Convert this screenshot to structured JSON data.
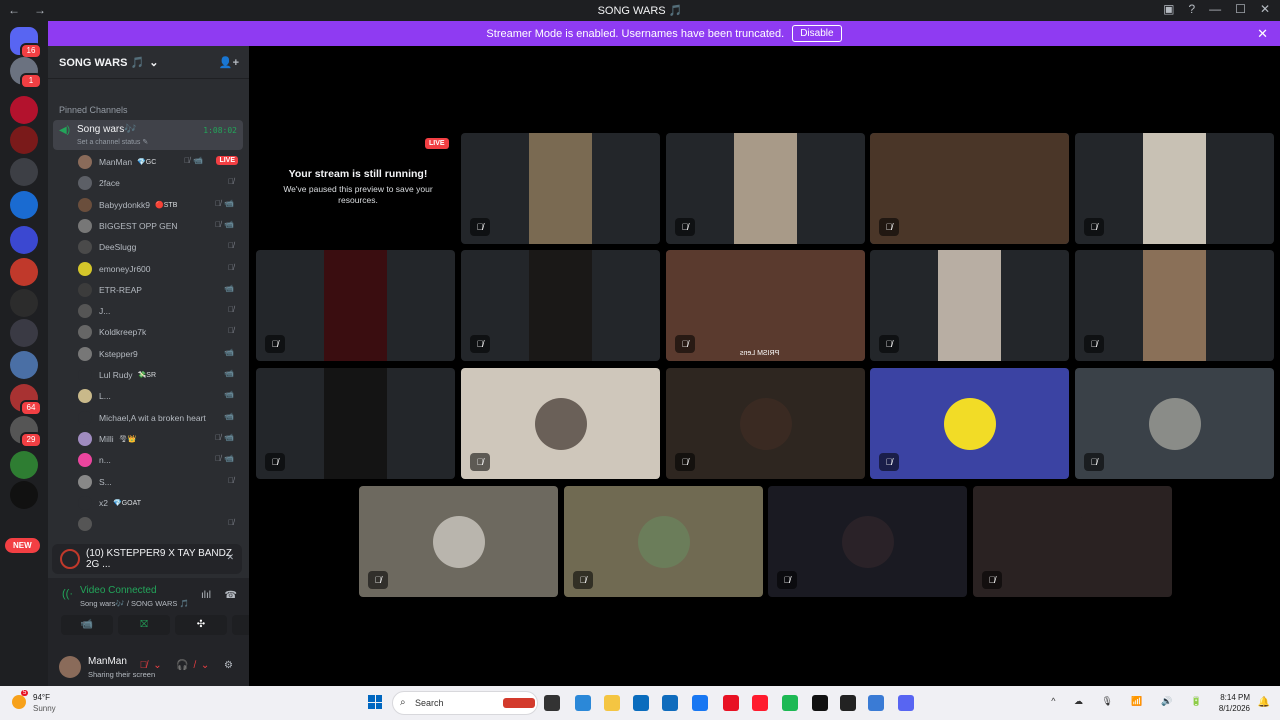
{
  "window": {
    "title": "SONG WARS 🎵",
    "title_icon": "crowd-emoji-icon",
    "back": "←",
    "forward": "→",
    "controls": [
      "▣",
      "?",
      "—",
      "☐",
      "✕"
    ]
  },
  "banner": {
    "text": "Streamer Mode is enabled. Usernames have been truncated.",
    "button": "Disable",
    "close": "✕",
    "color": "#8f3bf2"
  },
  "guilds": {
    "items": [
      {
        "name": "discord-home-icon",
        "badge": "16",
        "color": "#5865f2"
      },
      {
        "name": "server-icon-2",
        "badge": "1",
        "color": "#6b7280"
      },
      {
        "name": "server-icon-3",
        "badge": "",
        "color": "#b3122d"
      },
      {
        "name": "server-icon-4",
        "badge": "",
        "color": "#7a1a1a"
      },
      {
        "name": "server-icon-songwars",
        "badge": "",
        "color": "#3d3f45"
      },
      {
        "name": "server-icon-bay",
        "badge": "",
        "color": "#1a6bd1"
      },
      {
        "name": "folder-icon",
        "badge": "",
        "color": "#3b48d1"
      },
      {
        "name": "server-icon-m",
        "badge": "",
        "color": "#c0392b"
      },
      {
        "name": "server-icon-kozaal",
        "badge": "",
        "color": "#2c2c2c"
      },
      {
        "name": "server-icon-10",
        "badge": "",
        "color": "#3a3a44"
      },
      {
        "name": "server-icon-11",
        "badge": "",
        "color": "#4a6fa5"
      },
      {
        "name": "server-icon-12",
        "badge": "64",
        "color": "#a83232"
      },
      {
        "name": "server-icon-13",
        "badge": "29",
        "color": "#555"
      },
      {
        "name": "server-icon-14",
        "badge": "",
        "color": "#2e7d32"
      },
      {
        "name": "server-icon-ng",
        "badge": "",
        "color": "#111"
      }
    ],
    "new_label": "NEW"
  },
  "server": {
    "name": "SONG WARS 🎵",
    "chevron": "⌄",
    "add_icon": "👤+",
    "pinned_label": "Pinned Channels",
    "voice_channel": {
      "name": "Song wars🎶",
      "subtitle": "Set a channel status ✎",
      "time": "1:08:02"
    }
  },
  "members": [
    {
      "name": "ManMan",
      "tag": "💎GC",
      "icons": "🎙̸📹",
      "live": "LIVE",
      "color": "#8a6b5a"
    },
    {
      "name": "2face",
      "tag": "",
      "icons": "🎙̸",
      "live": "",
      "color": "#5c5f66"
    },
    {
      "name": "Babyydonkk9",
      "tag": "🔴STB",
      "icons": "🎙̸📹",
      "live": "",
      "color": "#6a4e3c"
    },
    {
      "name": "BIGGEST OPP GEN",
      "tag": "",
      "icons": "🎙̸📹",
      "live": "",
      "color": "#777"
    },
    {
      "name": "DeeSlugg",
      "tag": "",
      "icons": "🎙̸",
      "live": "",
      "color": "#4a4a4a"
    },
    {
      "name": "emoneyJr600",
      "tag": "",
      "icons": "🎙̸",
      "live": "",
      "color": "#d4c62a"
    },
    {
      "name": "ETR-REAP",
      "tag": "",
      "icons": "📹",
      "live": "",
      "color": "#3c3c3c"
    },
    {
      "name": "J...",
      "tag": "",
      "icons": "🎙̸",
      "live": "",
      "color": "#555"
    },
    {
      "name": "Koldkreep7k",
      "tag": "",
      "icons": "🎙̸",
      "live": "",
      "color": "#666"
    },
    {
      "name": "Kstepper9",
      "tag": "",
      "icons": "📹",
      "live": "",
      "color": "#777"
    },
    {
      "name": "Lul Rudy",
      "tag": "💸SR",
      "icons": "📹",
      "live": "",
      "color": "#2b2d31"
    },
    {
      "name": "L...",
      "tag": "",
      "icons": "📹",
      "live": "",
      "color": "#c9b98a"
    },
    {
      "name": "Michael,A wit a broken heart",
      "tag": "",
      "icons": "📹",
      "live": "",
      "color": "#2b2d31"
    },
    {
      "name": "Milli",
      "tag": "🌪👑",
      "icons": "🎙̸📹",
      "live": "",
      "color": "#a08cc0"
    },
    {
      "name": "n...",
      "tag": "",
      "icons": "🎙̸📹",
      "live": "",
      "color": "#eb459e"
    },
    {
      "name": "S...",
      "tag": "",
      "icons": "🎙̸",
      "live": "",
      "color": "#888"
    },
    {
      "name": "x2",
      "tag": "💎GOAT",
      "icons": "",
      "live": "",
      "color": "#2b2d31"
    },
    {
      "name": "",
      "tag": "",
      "icons": "🎙̸",
      "live": "",
      "color": "#555"
    }
  ],
  "now_playing": {
    "text": "(10) KSTEPPER9 X TAY BANDZ 2G ...",
    "close": "✕"
  },
  "voice": {
    "status": "Video Connected",
    "location": "Song wars🎶 / SONG WARS 🎵",
    "buttons": [
      "📹",
      "⛝",
      "✣",
      "⟳"
    ]
  },
  "user": {
    "name": "ManMan",
    "status": "Sharing their screen",
    "controls": "🎙̸⌄ 🎧̸⌄",
    "settings": "⚙"
  },
  "stage": {
    "paused_title": "Your stream is still running!",
    "paused_desc": "We've paused this preview to save your resources.",
    "live_badge": "LIVE",
    "lens_text": "PRISM Lens",
    "tiles": [
      {
        "name": "tile-1-2",
        "bg": "#23262a",
        "video": "#7a6a52",
        "avatar": ""
      },
      {
        "name": "tile-1-3",
        "bg": "#23262a",
        "video": "#a89a88",
        "avatar": ""
      },
      {
        "name": "tile-1-4",
        "bg": "#1e3a5c",
        "video": "#4a3628",
        "avatar": ""
      },
      {
        "name": "tile-1-5",
        "bg": "#23262a",
        "video": "#c8c1b4",
        "avatar": ""
      },
      {
        "name": "tile-2-1",
        "bg": "#23262a",
        "video": "#3a0d10",
        "avatar": ""
      },
      {
        "name": "tile-2-2",
        "bg": "#23262a",
        "video": "#1a1817",
        "avatar": ""
      },
      {
        "name": "tile-2-3",
        "bg": "#3a2a40",
        "video": "#5a3a2e",
        "avatar": ""
      },
      {
        "name": "tile-2-4",
        "bg": "#23262a",
        "video": "#b8aea3",
        "avatar": ""
      },
      {
        "name": "tile-2-5",
        "bg": "#23262a",
        "video": "#8a7058",
        "avatar": ""
      },
      {
        "name": "tile-3-1",
        "bg": "#23262a",
        "video": "#141414",
        "avatar": ""
      },
      {
        "name": "tile-3-2",
        "bg": "#cfc7bb",
        "video": "",
        "avatar": "#6a6058"
      },
      {
        "name": "tile-3-3",
        "bg": "#2e2620",
        "video": "",
        "avatar": "#3a2a22"
      },
      {
        "name": "tile-3-4",
        "bg": "#3b43a3",
        "video": "",
        "avatar": "#f2dc26"
      },
      {
        "name": "tile-3-5",
        "bg": "#3a4148",
        "video": "",
        "avatar": "#8a8c88"
      },
      {
        "name": "tile-4-1",
        "bg": "#6d695f",
        "video": "",
        "avatar": "#b9b5ad"
      },
      {
        "name": "tile-4-2",
        "bg": "#706a52",
        "video": "",
        "avatar": "#6b7d5a"
      },
      {
        "name": "tile-4-3",
        "bg": "#1a1a22",
        "video": "",
        "avatar": "#2a2228"
      },
      {
        "name": "tile-4-4",
        "bg": "#2a2222",
        "video": "",
        "avatar": "#2a2222"
      }
    ],
    "mute_icon": "🎙̸"
  },
  "taskbar": {
    "weather_temp": "94°F",
    "weather_desc": "Sunny",
    "weather_badge": "5",
    "search": "Search",
    "apps": [
      {
        "name": "shoe-app-icon",
        "color": "#d33a2c"
      },
      {
        "name": "taskview-icon",
        "color": "#333"
      },
      {
        "name": "photos-icon",
        "color": "#2b88d8"
      },
      {
        "name": "file-explorer-icon",
        "color": "#f4c542"
      },
      {
        "name": "store-icon",
        "color": "#0a6cbd"
      },
      {
        "name": "outlook-icon",
        "color": "#0f6cbd"
      },
      {
        "name": "facebook-icon",
        "color": "#1877f2"
      },
      {
        "name": "red-app-icon",
        "color": "#e81123"
      },
      {
        "name": "opera-icon",
        "color": "#ff1b2d"
      },
      {
        "name": "spotify-icon",
        "color": "#1db954"
      },
      {
        "name": "capcut-icon",
        "color": "#111"
      },
      {
        "name": "obs-icon",
        "color": "#222"
      },
      {
        "name": "maps-app-icon",
        "color": "#3a7bd5"
      },
      {
        "name": "discord-taskbar-icon",
        "color": "#5865f2"
      }
    ],
    "tray": "^ ☁ 🎙 📶 🔊 🔋",
    "time": "8:14 PM",
    "date": "8/1/2026",
    "bell": "🔔"
  }
}
